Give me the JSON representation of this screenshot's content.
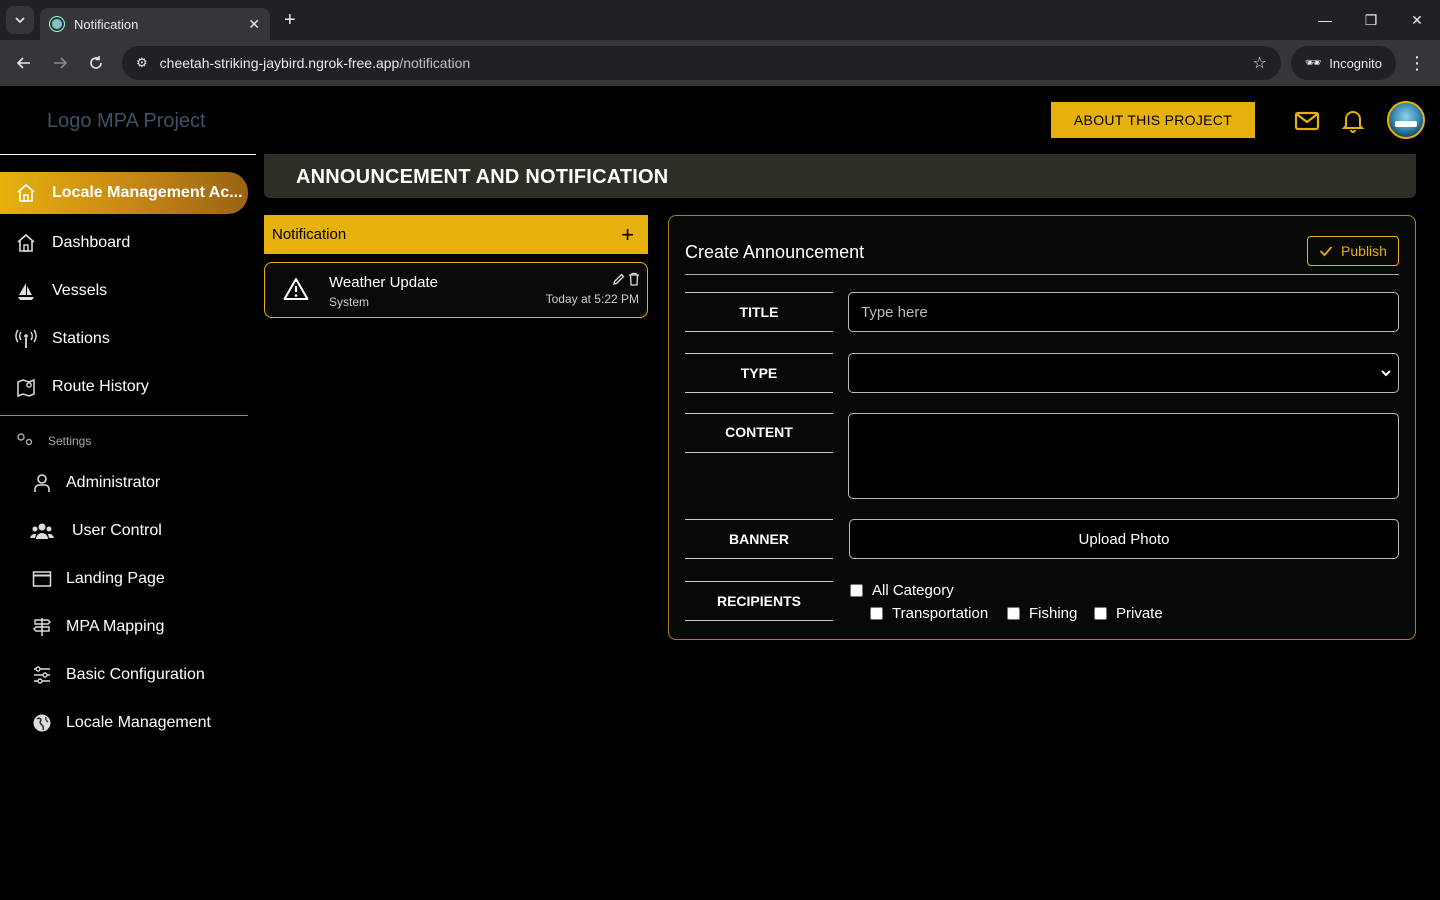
{
  "browser": {
    "tab_title": "Notification",
    "url_host": "cheetah-striking-jaybird.ngrok-free.app",
    "url_path": "/notification",
    "incognito_label": "Incognito"
  },
  "header": {
    "logo": "Logo MPA Project",
    "about_button": "ABOUT THIS PROJECT",
    "accent_color": "#e6b10c"
  },
  "sidebar": {
    "active_item": "Locale Management Ac...",
    "items": [
      {
        "label": "Dashboard",
        "icon": "home-icon"
      },
      {
        "label": "Vessels",
        "icon": "sailboat-icon"
      },
      {
        "label": "Stations",
        "icon": "antenna-icon"
      },
      {
        "label": "Route History",
        "icon": "map-pin-icon"
      }
    ],
    "settings_label": "Settings",
    "settings_items": [
      {
        "label": "Administrator",
        "icon": "user-icon"
      },
      {
        "label": "User Control",
        "icon": "users-icon"
      },
      {
        "label": "Landing Page",
        "icon": "window-icon"
      },
      {
        "label": "MPA Mapping",
        "icon": "signpost-icon"
      },
      {
        "label": "Basic Configuration",
        "icon": "sliders-icon"
      },
      {
        "label": "Locale Management",
        "icon": "globe-icon"
      }
    ]
  },
  "main": {
    "page_title": "ANNOUNCEMENT AND NOTIFICATION",
    "notifications": {
      "header": "Notification",
      "items": [
        {
          "title": "Weather Update",
          "source": "System",
          "time": "Today at 5:22 PM"
        }
      ]
    },
    "form": {
      "title": "Create Announcement",
      "publish_label": "Publish",
      "title_label": "TITLE",
      "title_placeholder": "Type here",
      "type_label": "TYPE",
      "content_label": "CONTENT",
      "banner_label": "BANNER",
      "upload_label": "Upload Photo",
      "recipients_label": "RECIPIENTS",
      "recipients": {
        "all": "All Category",
        "options": [
          "Transportation",
          "Fishing",
          "Private"
        ]
      }
    }
  }
}
